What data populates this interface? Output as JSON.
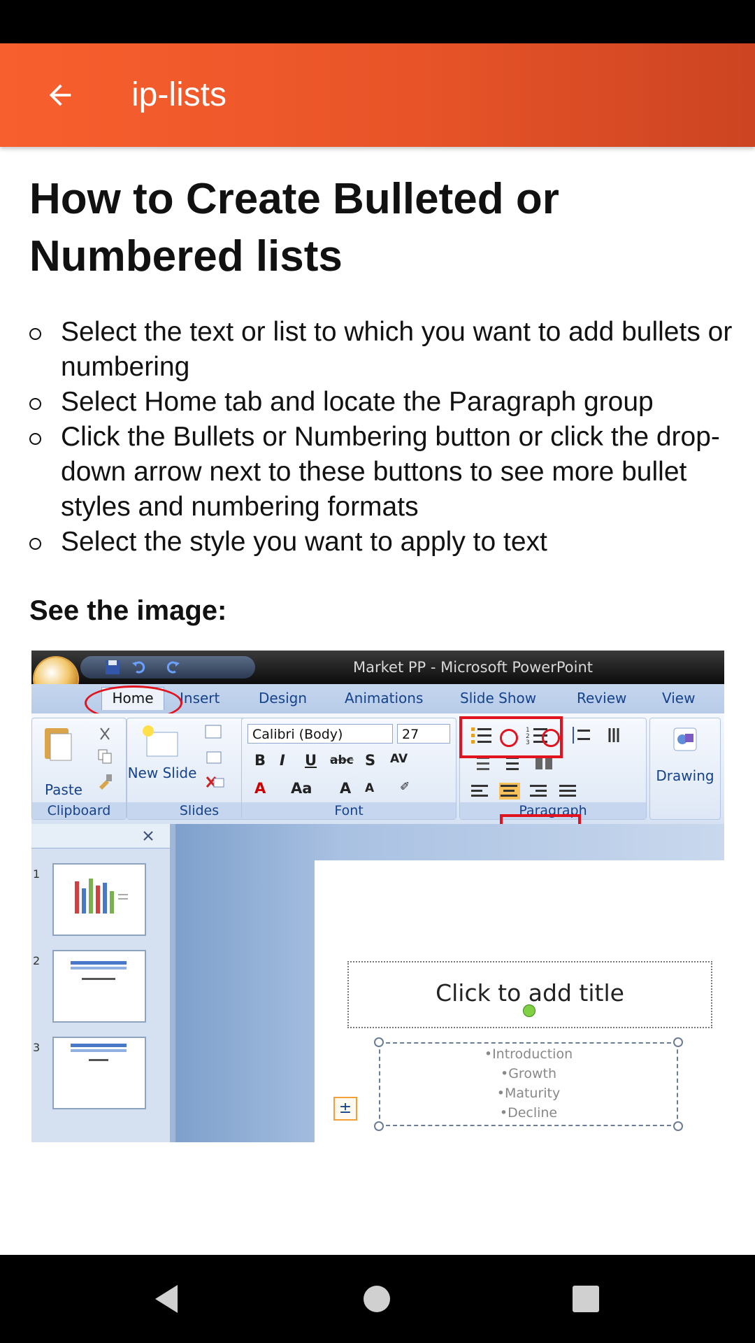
{
  "app_bar": {
    "title": "ip-lists",
    "color": "#f05a2a"
  },
  "article": {
    "heading": "How to Create Bulleted or Numbered lists",
    "steps": [
      "Select the text or list to which you want to add bullets or numbering",
      "Select Home tab and locate the Paragraph group",
      "Click the Bullets or Numbering button or click the drop-down arrow next to these buttons to see more bullet styles and numbering formats",
      "Select the style you want to apply to text"
    ],
    "see_image": "See the image:"
  },
  "screenshot": {
    "window_title": "Market PP  -  Microsoft PowerPoint",
    "tabs": [
      "Home",
      "Insert",
      "Design",
      "Animations",
      "Slide Show",
      "Review",
      "View"
    ],
    "groups": [
      "Clipboard",
      "Slides",
      "Font",
      "Paragraph"
    ],
    "paste_label": "Paste",
    "new_slide_label": "New Slide",
    "drawing_label": "Drawing",
    "font_name": "Calibri (Body)",
    "font_size": "27",
    "slide_numbers": [
      "1",
      "2",
      "3"
    ],
    "title_placeholder": "Click to add title",
    "bullets": [
      "•Introduction",
      "•Growth",
      "•Maturity",
      "•Decline"
    ]
  },
  "icons": {
    "back": "arrow-left-icon",
    "nav_back": "triangle-back-icon",
    "nav_home": "circle-home-icon",
    "nav_recent": "square-recent-icon"
  }
}
